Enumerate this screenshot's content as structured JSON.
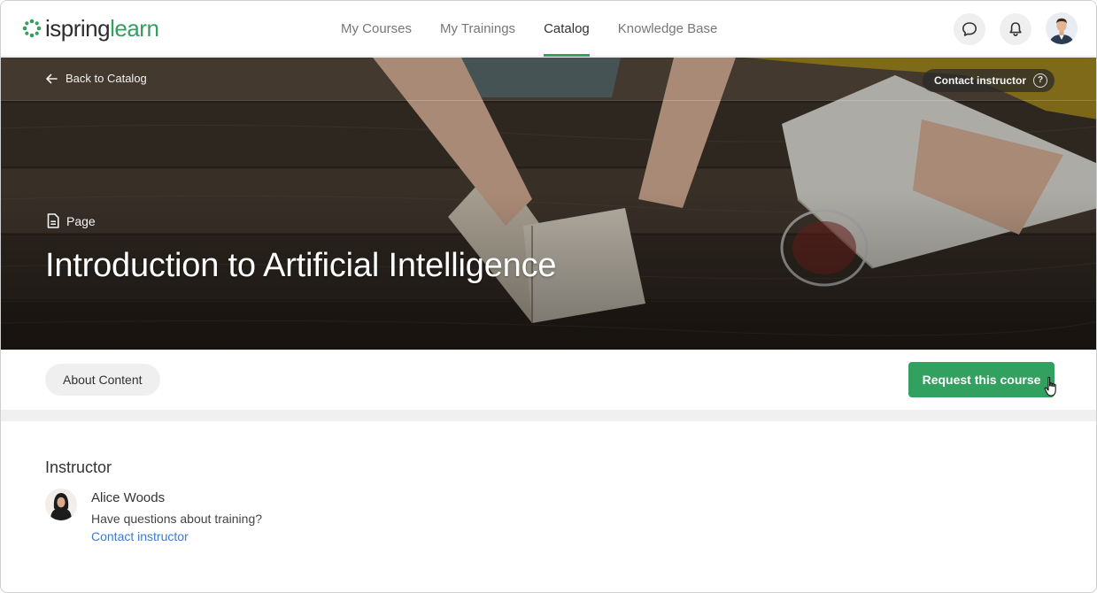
{
  "app": {
    "logo_part1": "ispring",
    "logo_part2": "learn",
    "brand_color": "#32a05f"
  },
  "nav": {
    "items": [
      {
        "label": "My Courses",
        "active": false
      },
      {
        "label": "My Trainings",
        "active": false
      },
      {
        "label": "Catalog",
        "active": true
      },
      {
        "label": "Knowledge Base",
        "active": false
      }
    ]
  },
  "header_icons": [
    "chat-icon",
    "bell-icon",
    "user-avatar"
  ],
  "hero": {
    "back_label": "Back to Catalog",
    "contact_label": "Contact instructor",
    "contact_help": "?",
    "type_label": "Page",
    "title": "Introduction to Artificial Intelligence"
  },
  "tabs": {
    "about_label": "About Content",
    "request_label": "Request this course"
  },
  "instructor": {
    "section_title": "Instructor",
    "name": "Alice Woods",
    "question": "Have questions about training?",
    "contact_link": "Contact instructor"
  }
}
